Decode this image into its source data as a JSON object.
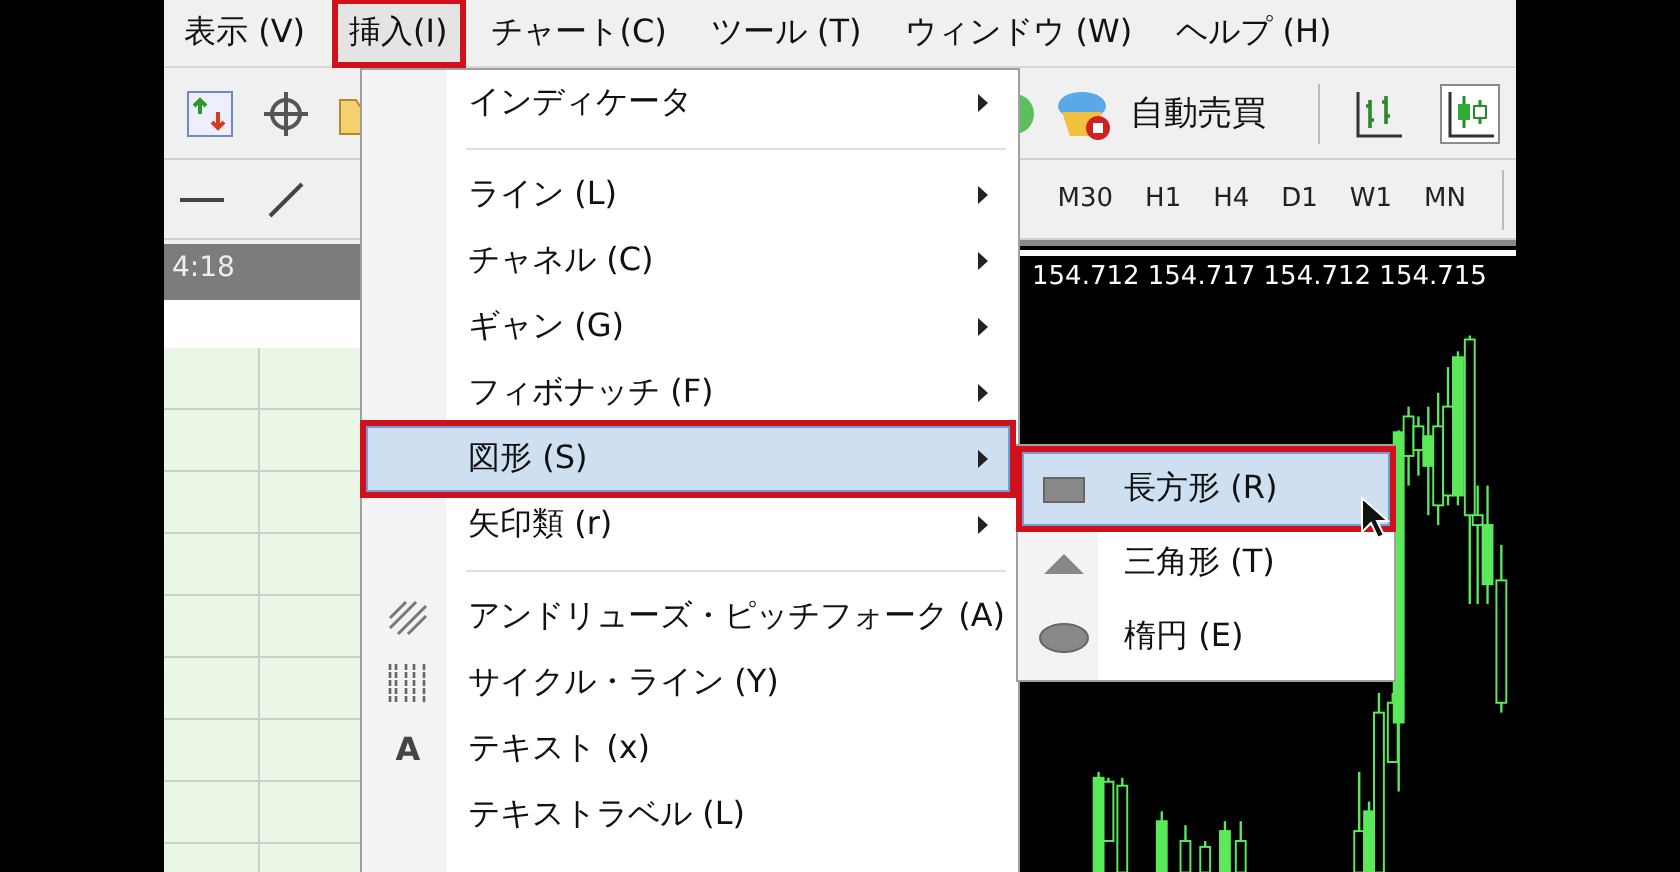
{
  "menu_bar": [
    {
      "label": "表示 (V)",
      "selected": false,
      "outlined": false
    },
    {
      "label": "挿入(I)",
      "selected": true,
      "outlined": true
    },
    {
      "label": "チャート(C)",
      "selected": false,
      "outlined": false
    },
    {
      "label": "ツール (T)",
      "selected": false,
      "outlined": false
    },
    {
      "label": "ウィンドウ (W)",
      "selected": false,
      "outlined": false
    },
    {
      "label": "ヘルプ (H)",
      "selected": false,
      "outlined": false
    }
  ],
  "toolbar": {
    "auto_trade": "自動売買"
  },
  "timeframes": [
    "M30",
    "H1",
    "H4",
    "D1",
    "W1",
    "MN"
  ],
  "left_panel": {
    "time": "4:18"
  },
  "chart": {
    "ohlc": "154.712 154.717 154.712 154.715"
  },
  "insert_menu": [
    {
      "kind": "item",
      "label": "インディケータ",
      "has_submenu": true,
      "selected": false,
      "outlined": false
    },
    {
      "kind": "separator"
    },
    {
      "kind": "item",
      "label": "ライン (L)",
      "has_submenu": true,
      "selected": false,
      "outlined": false
    },
    {
      "kind": "item",
      "label": "チャネル (C)",
      "has_submenu": true,
      "selected": false,
      "outlined": false
    },
    {
      "kind": "item",
      "label": "ギャン (G)",
      "has_submenu": true,
      "selected": false,
      "outlined": false
    },
    {
      "kind": "item",
      "label": "フィボナッチ (F)",
      "has_submenu": true,
      "selected": false,
      "outlined": false
    },
    {
      "kind": "item",
      "label": "図形 (S)",
      "has_submenu": true,
      "selected": true,
      "outlined": true
    },
    {
      "kind": "item",
      "label": "矢印類 (r)",
      "has_submenu": true,
      "selected": false,
      "outlined": false
    },
    {
      "kind": "separator"
    },
    {
      "kind": "item",
      "label": "アンドリューズ・ピッチフォーク (A)",
      "has_submenu": false,
      "selected": false,
      "outlined": false
    },
    {
      "kind": "item",
      "label": "サイクル・ライン (Y)",
      "has_submenu": false,
      "selected": false,
      "outlined": false
    },
    {
      "kind": "item",
      "label": "テキスト (x)",
      "glyph": "A",
      "has_submenu": false,
      "selected": false,
      "outlined": false
    },
    {
      "kind": "item",
      "label": "テキストラベル (L)",
      "has_submenu": false,
      "selected": false,
      "outlined": false
    }
  ],
  "shapes_submenu": [
    {
      "label": "長方形 (R)",
      "selected": true,
      "outlined": true
    },
    {
      "label": "三角形 (T)",
      "selected": false,
      "outlined": false
    },
    {
      "label": "楕円 (E)",
      "selected": false,
      "outlined": false
    }
  ]
}
